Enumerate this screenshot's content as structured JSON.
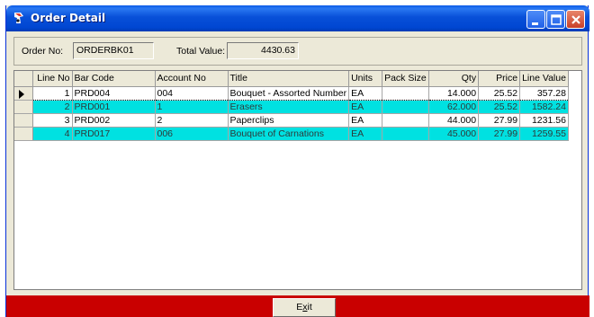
{
  "window": {
    "title": "Order Detail"
  },
  "header": {
    "order_no_label": "Order No:",
    "order_no_value": "ORDERBK01",
    "total_value_label": "Total Value:",
    "total_value_value": "4430.63"
  },
  "grid": {
    "columns": [
      "Line No",
      "Bar Code",
      "Account No",
      "Title",
      "Units",
      "Pack Size",
      "Qty",
      "Price",
      "Line Value"
    ],
    "rows": [
      {
        "line_no": "1",
        "bar_code": "PRD004",
        "account_no": "004",
        "title": "Bouquet - Assorted Number",
        "units": "EA",
        "pack_size": "",
        "qty": "14.000",
        "price": "25.52",
        "line_value": "357.28",
        "highlight": false,
        "current": true
      },
      {
        "line_no": "2",
        "bar_code": "PRD001",
        "account_no": "1",
        "title": "Erasers",
        "units": "EA",
        "pack_size": "",
        "qty": "62.000",
        "price": "25.52",
        "line_value": "1582.24",
        "highlight": true,
        "current": false
      },
      {
        "line_no": "3",
        "bar_code": "PRD002",
        "account_no": "2",
        "title": "Paperclips",
        "units": "EA",
        "pack_size": "",
        "qty": "44.000",
        "price": "27.99",
        "line_value": "1231.56",
        "highlight": false,
        "current": false
      },
      {
        "line_no": "4",
        "bar_code": "PRD017",
        "account_no": "006",
        "title": "Bouquet of Carnations",
        "units": "EA",
        "pack_size": "",
        "qty": "45.000",
        "price": "27.99",
        "line_value": "1259.55",
        "highlight": true,
        "current": false
      }
    ]
  },
  "footer": {
    "exit_prefix": "E",
    "exit_underlined": "x",
    "exit_suffix": "it"
  },
  "colors": {
    "title_bar": "#0046d2",
    "row_highlight": "#00e1e1",
    "footer": "#c90000",
    "dialog_bg": "#ece9d8"
  },
  "icons": {
    "app": "app-logo-icon",
    "minimize": "minimize-icon",
    "maximize": "maximize-icon",
    "close": "close-icon",
    "row_pointer": "row-pointer-icon"
  }
}
